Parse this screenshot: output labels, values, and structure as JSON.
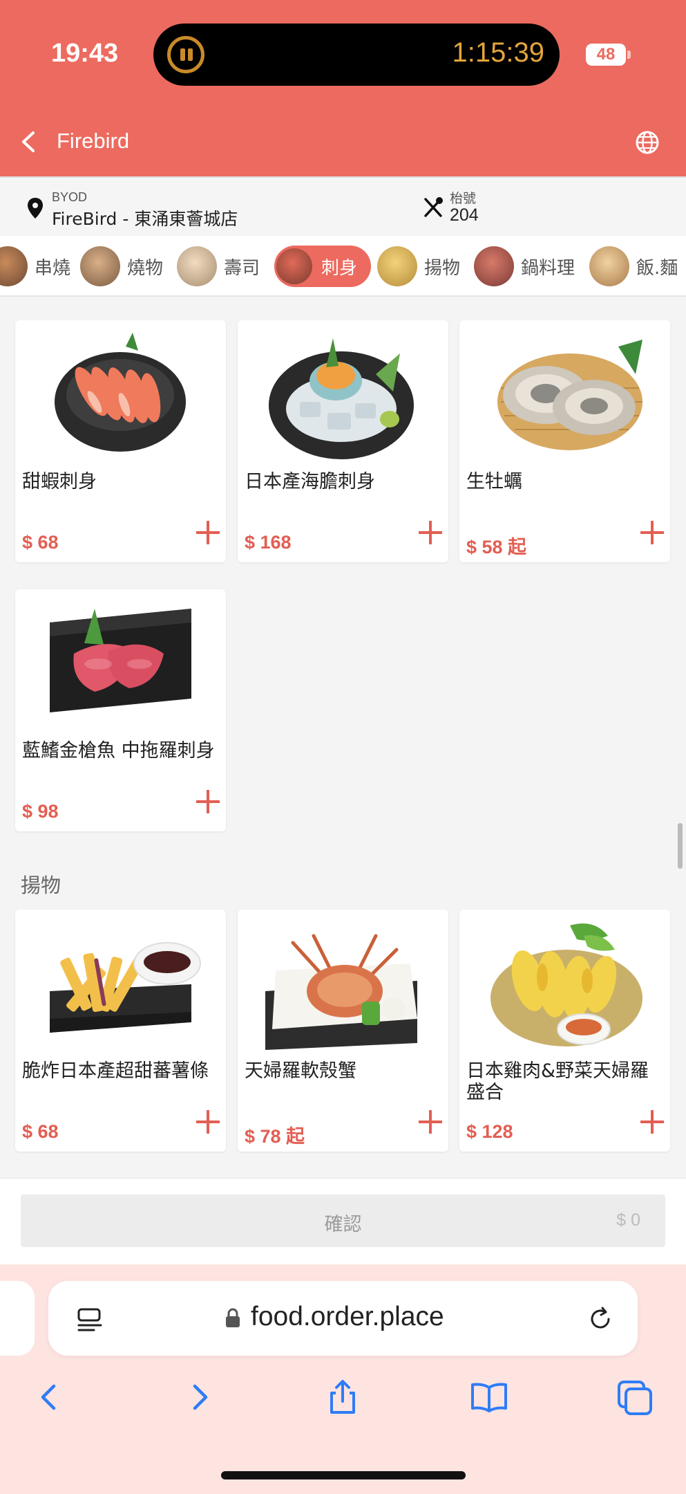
{
  "status_bar": {
    "time": "19:43",
    "timer": "1:15:39",
    "battery": "48"
  },
  "header": {
    "title": "Firebird"
  },
  "store_info": {
    "mode": "BYOD",
    "name": "FireBird - 東涌東薈城店",
    "table_label": "枱號",
    "table_number": "204"
  },
  "categories": [
    {
      "label": "串燒",
      "active": false,
      "color": "#8a6a50"
    },
    {
      "label": "燒物",
      "active": false,
      "color": "#9a7b58"
    },
    {
      "label": "壽司",
      "active": false,
      "color": "#c7b39a"
    },
    {
      "label": "刺身",
      "active": true,
      "color": "#b04a3a"
    },
    {
      "label": "揚物",
      "active": false,
      "color": "#d9b35a"
    },
    {
      "label": "鍋料理",
      "active": false,
      "color": "#a0524a"
    },
    {
      "label": "飯.麵",
      "active": false,
      "color": "#c9a070"
    }
  ],
  "items": [
    {
      "name": "甜蝦刺身",
      "price": "$ 68",
      "image": "sweet-shrimp-sashimi"
    },
    {
      "name": "日本產海膽刺身",
      "price": "$ 168",
      "image": "sea-urchin-sashimi"
    },
    {
      "name": "生牡蠣",
      "price": "$ 58 起",
      "image": "raw-oysters"
    },
    {
      "name": "藍鰭金槍魚 中拖羅刺身",
      "price": "$ 98",
      "image": "tuna-chutoro-sashimi"
    }
  ],
  "section2": {
    "title": "揚物",
    "items": [
      {
        "name": "脆炸日本產超甜蕃薯條",
        "price": "$ 68",
        "image": "sweet-potato-fries"
      },
      {
        "name": "天婦羅軟殼蟹",
        "price": "$ 78 起",
        "image": "soft-shell-crab-tempura"
      },
      {
        "name": "日本雞肉&野菜天婦羅盛合",
        "price": "$ 128",
        "image": "chicken-vegetable-tempura"
      }
    ]
  },
  "confirm": {
    "label": "確認",
    "total": "$ 0"
  },
  "browser": {
    "url": "food.order.place"
  },
  "colors": {
    "brand": "#ec6a5f",
    "price": "#e35e52"
  }
}
